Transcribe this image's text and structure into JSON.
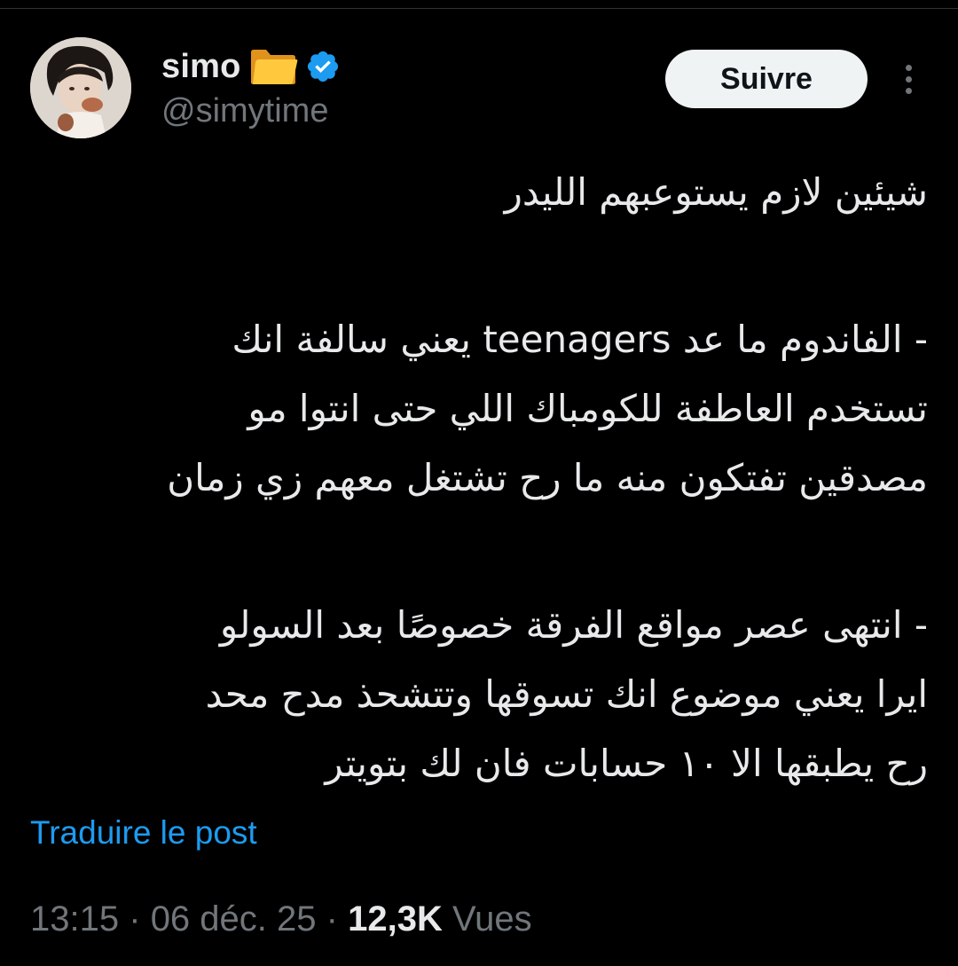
{
  "author": {
    "display_name": "simo",
    "handle": "@simytime",
    "badges": [
      "folder-icon",
      "verified-icon"
    ],
    "verified_color": "#1d9bf0"
  },
  "actions": {
    "follow_label": "Suivre"
  },
  "tweet": {
    "lines": [
      "شيئين لازم يستوعبهم الليدر",
      "",
      "- الفاندوم ما عد teenagers يعني سالفة انك",
      "تستخدم العاطفة للكومباك اللي حتى انتوا مو",
      "مصدقين تفتكون منه ما رح تشتغل معهم زي زمان",
      "",
      "- انتهى عصر مواقع الفرقة خصوصًا بعد السولو",
      "ايرا يعني موضوع انك تسوقها وتتشحذ مدح محد",
      "رح يطبقها الا ١٠ حسابات فان لك بتويتر"
    ],
    "translate_label": "Traduire le post"
  },
  "meta": {
    "time": "13:15",
    "separator": "·",
    "date": "06 déc. 25",
    "views_count": "12,3K",
    "views_label": "Vues"
  },
  "colors": {
    "background": "#000000",
    "text": "#e7e9ea",
    "secondary": "#71767b",
    "link": "#1d9bf0"
  }
}
